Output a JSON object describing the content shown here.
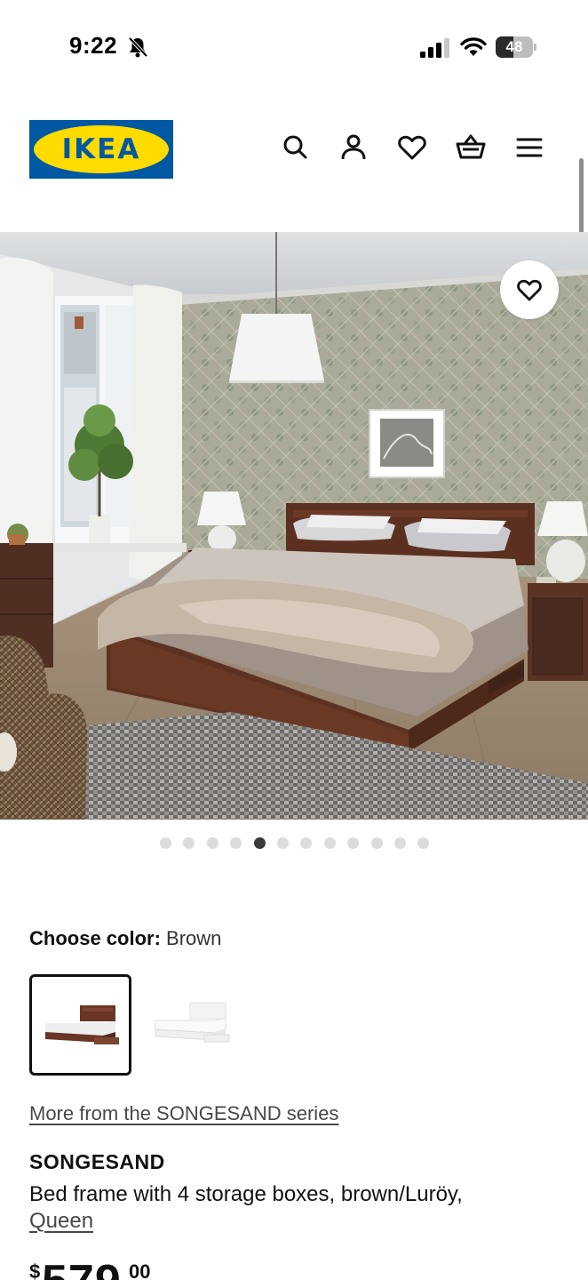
{
  "status_bar": {
    "time": "9:22",
    "battery": "48",
    "battery_level": 0.48
  },
  "header": {
    "logo_text": "IKEA"
  },
  "hero": {
    "carousel_total": 12,
    "carousel_active_index": 4
  },
  "product": {
    "color_label": "Choose color:",
    "color_value": "Brown",
    "swatches": [
      {
        "color": "brown",
        "selected": true
      },
      {
        "color": "white",
        "selected": false
      }
    ],
    "series_link": "More from the SONGESAND series",
    "name": "SONGESAND",
    "description": "Bed frame with 4 storage boxes, brown/Luröy,",
    "size": "Queen",
    "price": {
      "currency": "$",
      "dollars": "579",
      "cents": "00"
    }
  },
  "colors": {
    "ikea_blue": "#0058a3",
    "ikea_yellow": "#ffdb00",
    "text": "#111111",
    "link": "#484848"
  }
}
